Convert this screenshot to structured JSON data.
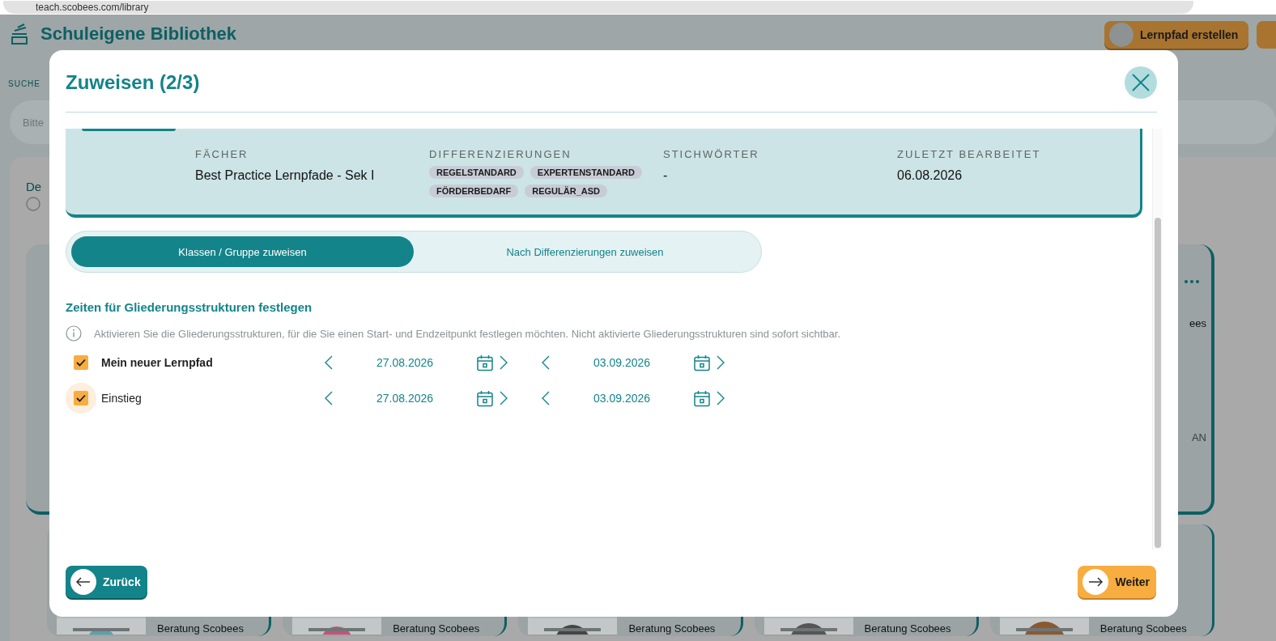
{
  "browser": {
    "url": "teach.scobees.com/library"
  },
  "page": {
    "title": "Schuleigene Bibliothek",
    "create_button": "Lernpfad erstellen",
    "search_label": "SUCHE",
    "search_placeholder": "Bitte",
    "section_label": "De",
    "card_fragments": [
      "ees",
      "AN"
    ],
    "bottom_cards": [
      {
        "author": "Beratung Scobees"
      },
      {
        "author": "Beratung Scobees"
      },
      {
        "author": "Beratung Scobees"
      },
      {
        "author": "Beratung Scobees"
      },
      {
        "author": "Beratung Scobees"
      }
    ]
  },
  "modal": {
    "title": "Zuweisen (2/3)",
    "details": [
      {
        "label": "FÄCHER",
        "value": "Best Practice Lernpfade - Sek I"
      },
      {
        "label": "DIFFERENZIERUNGEN",
        "chips": [
          "REGELSTANDARD",
          "EXPERTENSTANDARD",
          "FÖRDERBEDARF",
          "REGULÄR_ASD"
        ]
      },
      {
        "label": "STICHWÖRTER",
        "value": "-"
      },
      {
        "label": "ZULETZT BEARBEITET",
        "value": "06.08.2026"
      }
    ],
    "tabs": [
      {
        "label": "Klassen / Gruppe zuweisen",
        "selected": true
      },
      {
        "label": "Nach Differenzierungen zuweisen",
        "selected": false
      }
    ],
    "section_title": "Zeiten für Gliederungsstrukturen festlegen",
    "info": "Aktivieren Sie die Gliederungsstrukturen, für die Sie einen Start- und Endzeitpunkt festlegen möchten. Nicht aktivierte Gliederungsstrukturen sind sofort sichtbar.",
    "structures": [
      {
        "name": "Mein neuer Lernpfad",
        "checked": true,
        "focused": false,
        "start": "27.08.2026",
        "end": "03.09.2026",
        "children": [
          {
            "name": "Einstieg",
            "checked": true,
            "focused": true,
            "start": "27.08.2026",
            "end": "03.09.2026"
          }
        ]
      }
    ],
    "back_button": "Zurück",
    "next_button": "Weiter"
  }
}
